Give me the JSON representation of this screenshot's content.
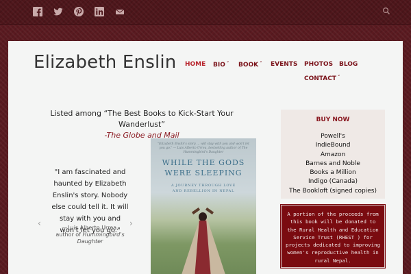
{
  "social": {
    "icons": [
      "facebook-icon",
      "twitter-icon",
      "pinterest-icon",
      "linkedin-icon",
      "email-icon"
    ]
  },
  "site": {
    "title": "Elizabeth Enslin"
  },
  "nav": {
    "home": "HOME",
    "bio": "BIO",
    "book": "BOOK",
    "events": "EVENTS",
    "photos": "PHOTOS",
    "blog": "BLOG",
    "contact": "CONTACT",
    "caret": "˅"
  },
  "headline": {
    "text": "Listed among “The Best Books to Kick-Start Your Wanderlust”",
    "source": "-The Globe and Mail"
  },
  "quote": {
    "text": "\"I am fascinated and haunted by Elizabeth Enslin's story. Nobody else could tell it. It will stay with you and won't let you go.\"",
    "author": "—Luis Alberto Urrea,",
    "author_of": "author of",
    "book": "Hummingbird's Daughter"
  },
  "carousel": {
    "prev": "‹",
    "next": "›"
  },
  "cover": {
    "blurb": "\"Elizabeth Enslin's story ... will stay with you and won't let you go.\" — Luis Alberto Urrea, bestselling author of The Hummingbird's Daughter",
    "title_line1": "WHILE THE GODS",
    "title_line2": "WERE SLEEPING",
    "subtitle_line1": "A JOURNEY THROUGH LOVE",
    "subtitle_line2": "AND REBELLION IN NEPAL"
  },
  "buy": {
    "heading": "BUY NOW",
    "links": [
      "Powell's",
      "IndieBound",
      "Amazon",
      "Barnes and Noble",
      "Books a Million",
      "Indigo (Canada)",
      "The Bookloft (signed copies)"
    ]
  },
  "donate": {
    "text": "A portion of the proceeds from this book will be donated to the Rural Health and Education Service Trust (RHEST ) for projects dedicated to improving women's reproductive health in rural Nepal."
  },
  "colors": {
    "accent": "#8a1a22",
    "nav_active": "#b8242c",
    "banner_bg": "#5a1a20",
    "donate_bg": "#7a0b10"
  }
}
